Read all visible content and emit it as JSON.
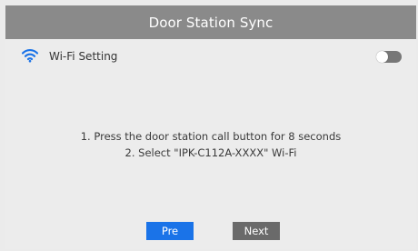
{
  "header": {
    "title": "Door Station Sync"
  },
  "wifi": {
    "icon": "wifi-icon",
    "label": "Wi-Fi Setting",
    "toggle_state": "off",
    "icon_color": "#1a73e8"
  },
  "instructions": {
    "line1": "1. Press the door station call button for 8 seconds",
    "line2": "2. Select \"IPK-C112A-XXXX\" Wi-Fi"
  },
  "buttons": {
    "pre_label": "Pre",
    "next_label": "Next",
    "pre_color": "#1a73e8",
    "next_color": "#6a6a6a"
  }
}
